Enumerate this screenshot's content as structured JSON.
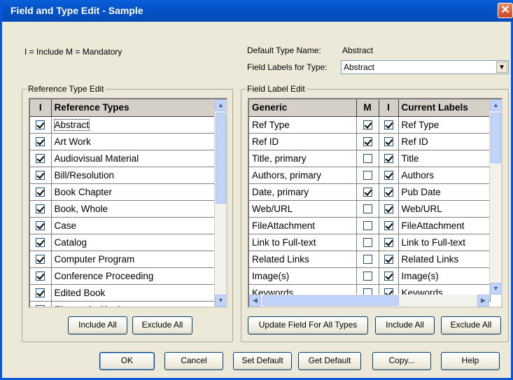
{
  "window": {
    "title": "Field and Type Edit - Sample",
    "close_glyph": "✕"
  },
  "legend": "I = Include   M = Mandatory",
  "default_type": {
    "label": "Default Type Name:",
    "value": "Abstract"
  },
  "field_labels": {
    "label": "Field Labels for Type:",
    "selected": "Abstract"
  },
  "ref_group": {
    "title": "Reference Type Edit",
    "headers": {
      "include": "I",
      "name": "Reference Types"
    },
    "rows": [
      {
        "checked": true,
        "name": "Abstract"
      },
      {
        "checked": true,
        "name": "Art Work"
      },
      {
        "checked": true,
        "name": "Audiovisual Material"
      },
      {
        "checked": true,
        "name": "Bill/Resolution"
      },
      {
        "checked": true,
        "name": "Book Chapter"
      },
      {
        "checked": true,
        "name": "Book, Whole"
      },
      {
        "checked": true,
        "name": "Case"
      },
      {
        "checked": true,
        "name": "Catalog"
      },
      {
        "checked": true,
        "name": "Computer Program"
      },
      {
        "checked": true,
        "name": "Conference Proceeding"
      },
      {
        "checked": true,
        "name": "Edited Book"
      },
      {
        "checked": true,
        "name": "Electronic Citation"
      }
    ],
    "include_all": "Include All",
    "exclude_all": "Exclude All"
  },
  "field_group": {
    "title": "Field Label Edit",
    "headers": {
      "generic": "Generic",
      "mandatory": "M",
      "include": "I",
      "current": "Current Labels"
    },
    "rows": [
      {
        "generic": "Ref Type",
        "m": true,
        "i": true,
        "current": "Ref Type"
      },
      {
        "generic": "Ref ID",
        "m": true,
        "i": true,
        "current": "Ref ID"
      },
      {
        "generic": "Title, primary",
        "m": false,
        "i": true,
        "current": "Title"
      },
      {
        "generic": "Authors, primary",
        "m": false,
        "i": true,
        "current": "Authors"
      },
      {
        "generic": "Date, primary",
        "m": true,
        "i": true,
        "current": "Pub Date"
      },
      {
        "generic": "Web/URL",
        "m": false,
        "i": true,
        "current": "Web/URL"
      },
      {
        "generic": "FileAttachment",
        "m": false,
        "i": true,
        "current": "FileAttachment"
      },
      {
        "generic": "Link to Full-text",
        "m": false,
        "i": true,
        "current": "Link to Full-text"
      },
      {
        "generic": "Related Links",
        "m": false,
        "i": true,
        "current": "Related Links"
      },
      {
        "generic": "Image(s)",
        "m": false,
        "i": true,
        "current": "Image(s)"
      },
      {
        "generic": "Keywords",
        "m": false,
        "i": true,
        "current": "Keywords"
      }
    ],
    "update_all": "Update Field For All Types",
    "include_all": "Include All",
    "exclude_all": "Exclude All"
  },
  "footer": {
    "ok": "OK",
    "cancel": "Cancel",
    "set_default": "Set Default",
    "get_default": "Get Default",
    "copy": "Copy...",
    "help": "Help"
  },
  "scroll_icons": {
    "up": "▲",
    "down": "▼",
    "left": "◀",
    "right": "▶"
  }
}
